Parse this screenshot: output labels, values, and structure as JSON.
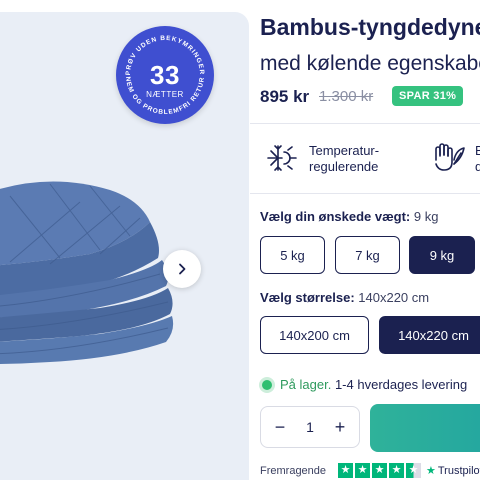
{
  "badge": {
    "number": "33",
    "unit": "NÆTTER",
    "ring_text_top": "PRØV UDEN BEKYMRINGER",
    "ring_text_bottom": "NEM OG PROBLEMFRI RETUR"
  },
  "product": {
    "title": "Bambus-tyngdedyne",
    "subtitle": "med kølende egenskaber",
    "price": "895 kr",
    "old_price": "1.300 kr",
    "save_badge": "SPAR 31%"
  },
  "features": [
    {
      "icon": "snowflake-sun-icon",
      "line1": "Temperatur-",
      "line2": "regulerende"
    },
    {
      "icon": "hand-feather-icon",
      "line1": "B",
      "line2": "d"
    }
  ],
  "weight": {
    "label": "Vælg din ønskede vægt:",
    "selected": "9 kg",
    "options": [
      "5 kg",
      "7 kg",
      "9 kg"
    ]
  },
  "size": {
    "label": "Vælg størrelse:",
    "selected": "140x220 cm",
    "options": [
      "140x200 cm",
      "140x220 cm"
    ]
  },
  "stock": {
    "status": "På lager.",
    "delivery": "1-4 hverdages levering"
  },
  "quantity": {
    "minus": "−",
    "value": "1",
    "plus": "+"
  },
  "trustpilot": {
    "label": "Fremragende",
    "stars": 4.5,
    "logo": "Trustpilot"
  },
  "colors": {
    "navy": "#1b2150",
    "badge_blue": "#3f4fd0",
    "save_green": "#35c27f",
    "cta_teal": "#2fb29a",
    "trustpilot_green": "#00b67a"
  }
}
